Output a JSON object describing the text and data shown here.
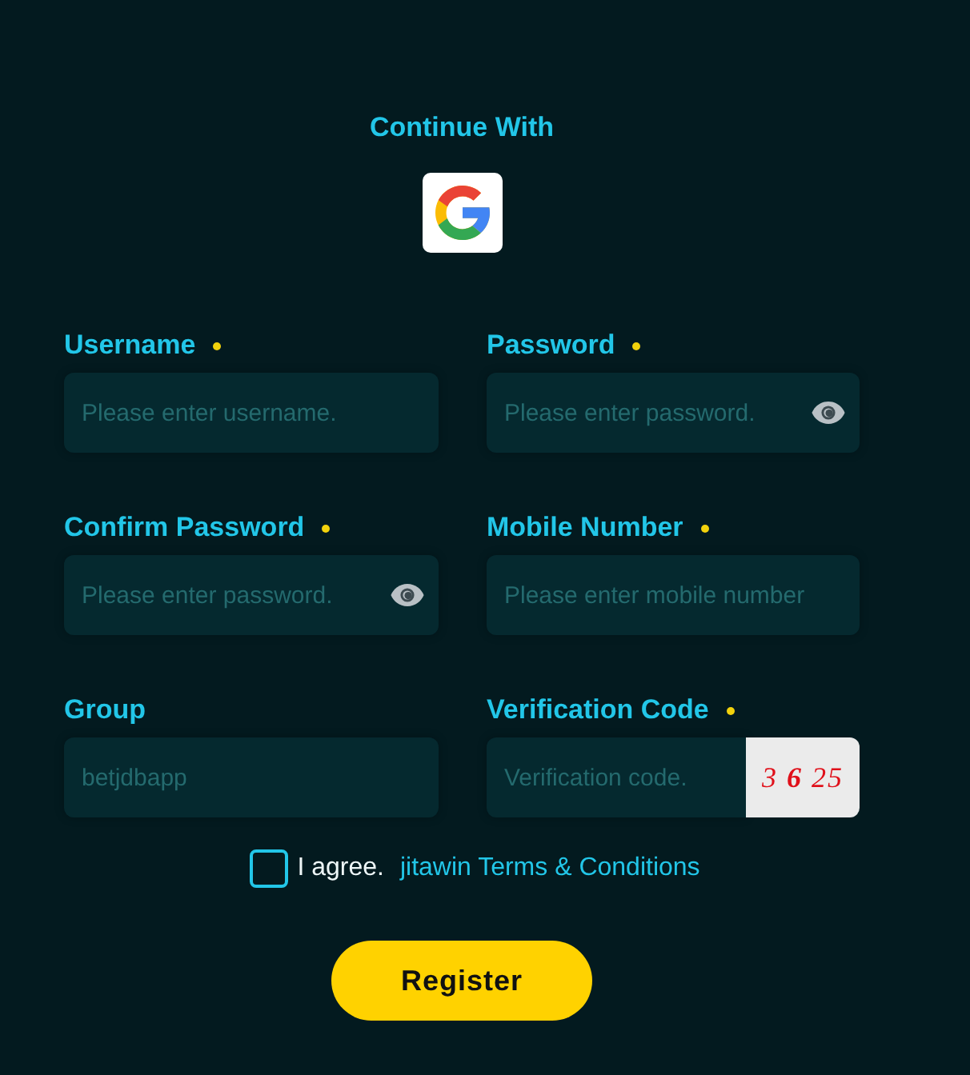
{
  "heading": "Continue With",
  "fields": [
    {
      "label": "Username",
      "required": true,
      "kind": "text",
      "placeholder": "Please enter username."
    },
    {
      "label": "Password",
      "required": true,
      "kind": "password",
      "placeholder": "Please enter password."
    },
    {
      "label": "Confirm Password",
      "required": true,
      "kind": "password",
      "placeholder": "Please enter password."
    },
    {
      "label": "Mobile Number",
      "required": true,
      "kind": "text",
      "placeholder": "Please enter mobile number"
    },
    {
      "label": "Group",
      "required": false,
      "kind": "text",
      "placeholder": "betjdbapp"
    },
    {
      "label": "Verification Code",
      "required": true,
      "kind": "captcha",
      "placeholder": "Verification code.",
      "captcha": "3 **6** 25"
    }
  ],
  "agreement": {
    "checked": false,
    "text": "I agree.",
    "link": "jitawin Terms & Conditions"
  },
  "register_button": "Register"
}
